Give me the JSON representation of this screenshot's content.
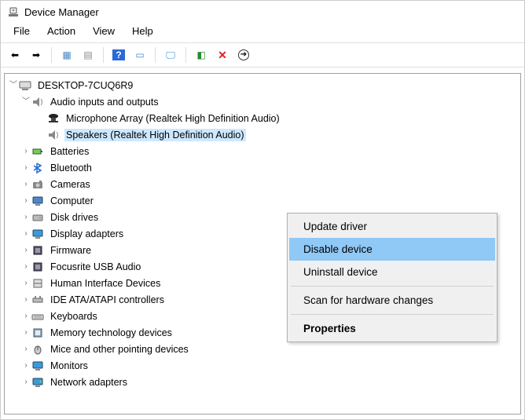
{
  "title": "Device Manager",
  "menu": {
    "file": "File",
    "action": "Action",
    "view": "View",
    "help": "Help"
  },
  "computer_name": "DESKTOP-7CUQ6R9",
  "audio_category": "Audio inputs and outputs",
  "devices": {
    "mic": "Microphone Array (Realtek High Definition Audio)",
    "speakers": "Speakers (Realtek High Definition Audio)"
  },
  "categories": [
    "Batteries",
    "Bluetooth",
    "Cameras",
    "Computer",
    "Disk drives",
    "Display adapters",
    "Firmware",
    "Focusrite USB Audio",
    "Human Interface Devices",
    "IDE ATA/ATAPI controllers",
    "Keyboards",
    "Memory technology devices",
    "Mice and other pointing devices",
    "Monitors",
    "Network adapters"
  ],
  "context_menu": {
    "update": "Update driver",
    "disable": "Disable device",
    "uninstall": "Uninstall device",
    "scan": "Scan for hardware changes",
    "properties": "Properties"
  }
}
